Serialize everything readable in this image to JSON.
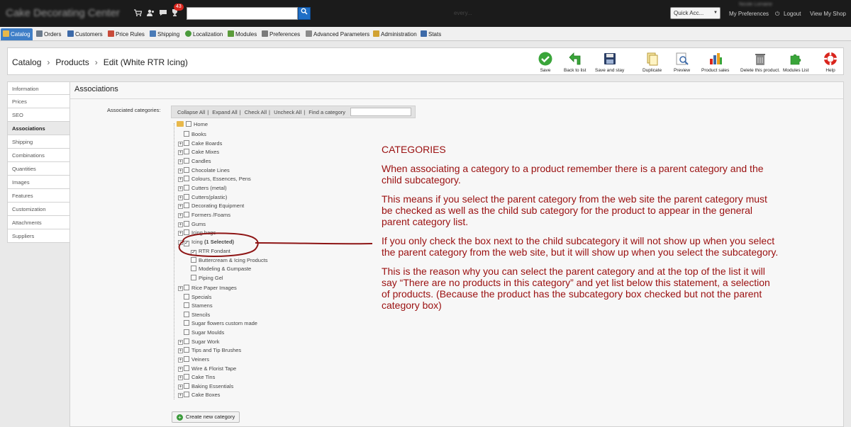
{
  "topbar": {
    "shop_name": "Cake Decorating Center",
    "notification_count": "43",
    "search_scope": "every...",
    "quick_access": "Quick Acc...",
    "user_name": "Nicole Lorraine",
    "my_preferences": "My Preferences",
    "logout": "Logout",
    "view_my_shop": "View My Shop"
  },
  "nav": {
    "tabs": [
      {
        "label": "Catalog",
        "color": "#e8b84a"
      },
      {
        "label": "Orders",
        "color": "#6b7b8c"
      },
      {
        "label": "Customers",
        "color": "#3d6aa8"
      },
      {
        "label": "Price Rules",
        "color": "#c84b3a"
      },
      {
        "label": "Shipping",
        "color": "#4a7bb7"
      },
      {
        "label": "Localization",
        "color": "#4a9a3c"
      },
      {
        "label": "Modules",
        "color": "#5b9b3a"
      },
      {
        "label": "Preferences",
        "color": "#7a7a7a"
      },
      {
        "label": "Advanced Parameters",
        "color": "#8a8a8a"
      },
      {
        "label": "Administration",
        "color": "#d1a232"
      },
      {
        "label": "Stats",
        "color": "#3d6aa8"
      }
    ]
  },
  "breadcrumb": {
    "catalog": "Catalog",
    "products": "Products",
    "current": "Edit (White RTR Icing)"
  },
  "toolbar": {
    "save": "Save",
    "back_to_list": "Back to list",
    "save_and_stay": "Save and stay",
    "duplicate": "Duplicate",
    "preview": "Preview",
    "product_sales": "Product sales",
    "delete": "Delete this product.",
    "modules_list": "Modules List",
    "help": "Help"
  },
  "sidetabs": [
    "Information",
    "Prices",
    "SEO",
    "Associations",
    "Shipping",
    "Combinations",
    "Quantities",
    "Images",
    "Features",
    "Customization",
    "Attachments",
    "Suppliers"
  ],
  "panel": {
    "title": "Associations",
    "associated_categories_label": "Associated categories:",
    "tree_toolbar": {
      "collapse_all": "Collapse All",
      "expand_all": "Expand All",
      "check_all": "Check All",
      "uncheck_all": "Uncheck All",
      "find": "Find a category"
    },
    "create_new_category": "Create new category"
  },
  "tree": {
    "home": "Home",
    "items": [
      {
        "label": "Books",
        "expandable": false,
        "checked": false
      },
      {
        "label": "Cake Boards",
        "expandable": true,
        "checked": false
      },
      {
        "label": "Cake Mixes",
        "expandable": true,
        "checked": false
      },
      {
        "label": "Candles",
        "expandable": true,
        "checked": false
      },
      {
        "label": "Chocolate Lines",
        "expandable": true,
        "checked": false
      },
      {
        "label": "Colours, Essences, Pens",
        "expandable": true,
        "checked": false
      },
      {
        "label": "Cutters (metal)",
        "expandable": true,
        "checked": false
      },
      {
        "label": "Cutters(plastic)",
        "expandable": true,
        "checked": false
      },
      {
        "label": "Decorating Equipment",
        "expandable": true,
        "checked": false
      },
      {
        "label": "Formers /Foams",
        "expandable": true,
        "checked": false
      },
      {
        "label": "Gums",
        "expandable": true,
        "checked": false
      },
      {
        "label": "Icing bags",
        "expandable": true,
        "checked": false
      }
    ],
    "icing": {
      "label": "Icing",
      "selected_note": "(1 Selected)"
    },
    "icing_children": [
      {
        "label": "RTR Fondant",
        "checked": true
      },
      {
        "label": "Buttercream & Icing Products",
        "checked": false
      },
      {
        "label": "Modeling & Gumpaste",
        "checked": false
      },
      {
        "label": "Piping Gel",
        "checked": false
      }
    ],
    "items_after": [
      {
        "label": "Rice Paper Images",
        "expandable": true
      },
      {
        "label": "Specials",
        "expandable": false
      },
      {
        "label": "Stamens",
        "expandable": false
      },
      {
        "label": "Stencils",
        "expandable": false
      },
      {
        "label": "Sugar flowers custom made",
        "expandable": false
      },
      {
        "label": "Sugar Moulds",
        "expandable": false
      },
      {
        "label": "Sugar Work",
        "expandable": true
      },
      {
        "label": "Tips and Tip Brushes",
        "expandable": true
      },
      {
        "label": "Veiners",
        "expandable": true
      },
      {
        "label": "Wire & Florist Tape",
        "expandable": true
      },
      {
        "label": "Cake Tins",
        "expandable": true
      },
      {
        "label": "Baking Essentials",
        "expandable": true
      },
      {
        "label": "Cake Boxes",
        "expandable": true
      }
    ]
  },
  "annotation": {
    "heading": "CATEGORIES",
    "p1": "When associating a category to a product remember there is a parent category and the child subcategory.",
    "p2": "This means if you select the parent category from the web site the parent category must be checked as well as the child sub category for the product to appear in the general parent category list.",
    "p3": "If you only check the box next to the child subcategory it will not show up when you select the parent category from the web site, but it will show up when you select the subcategory.",
    "p4": "This is the reason why you can select the parent category and at the top of the list it will say “There are no products in this category” and yet list below this statement, a selection of products. (Because the product has the subcategory box checked but not the parent category box)",
    "color": "#9a1010"
  }
}
